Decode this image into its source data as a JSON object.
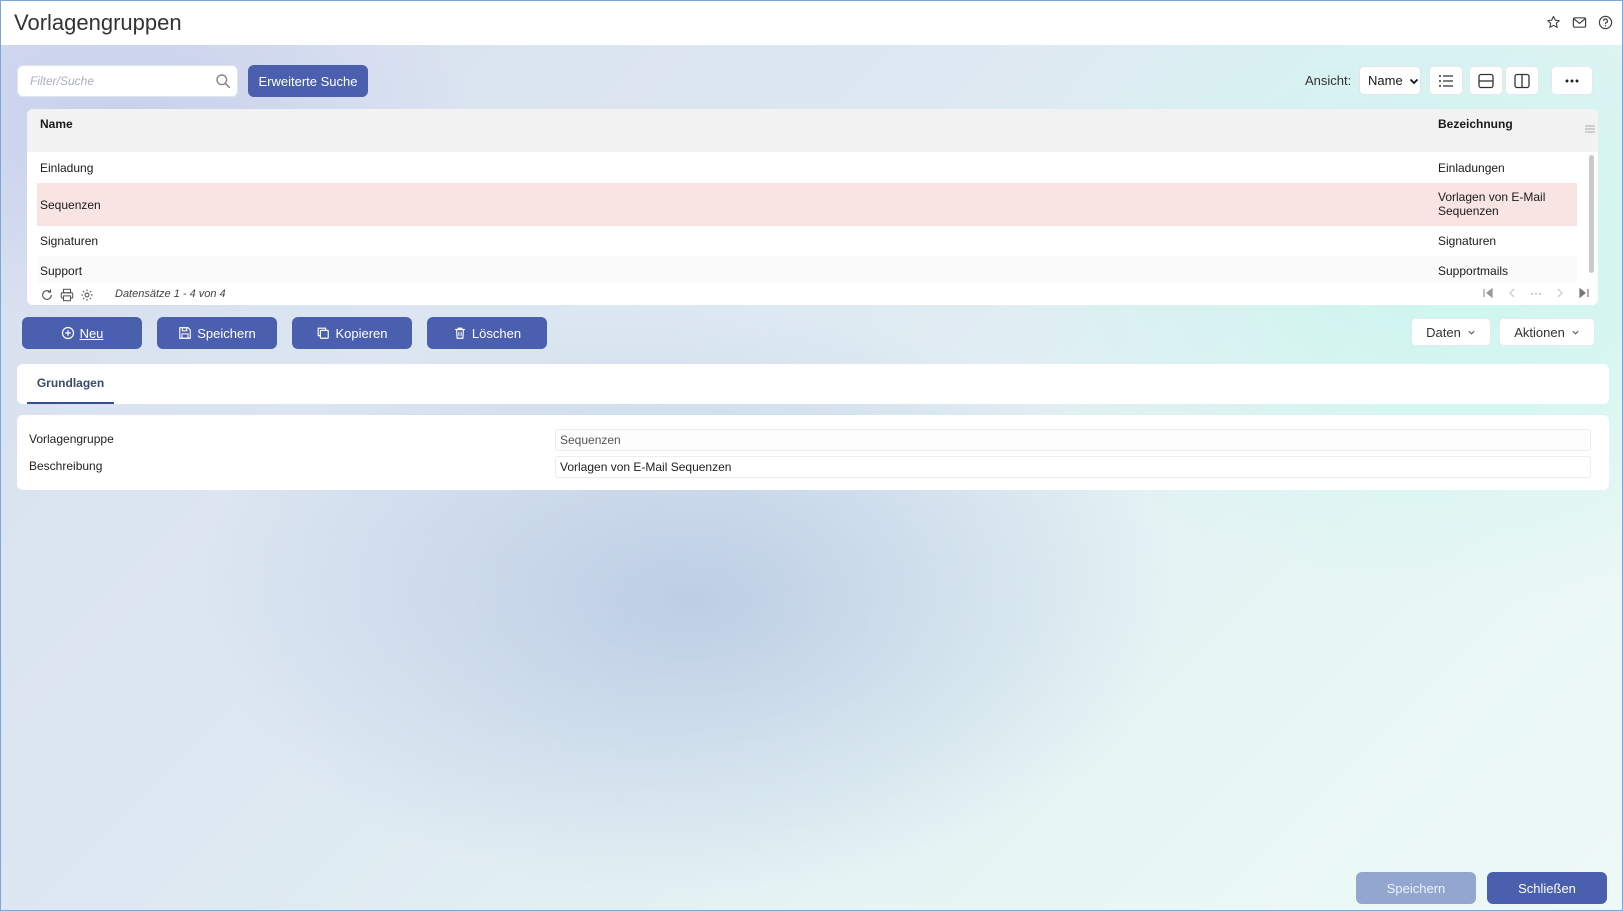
{
  "window": {
    "title": "Vorlagengruppen"
  },
  "search": {
    "placeholder": "Filter/Suche",
    "advanced_label": "Erweiterte Suche"
  },
  "view": {
    "label": "Ansicht:",
    "selected": "Name"
  },
  "grid": {
    "columns": [
      "Name",
      "Bezeichnung"
    ],
    "rows": [
      {
        "name": "Einladung",
        "bezeichnung": "Einladungen"
      },
      {
        "name": "Sequenzen",
        "bezeichnung": "Vorlagen von E-Mail Sequenzen",
        "bezeichnung_line1": "Vorlagen von E-Mail",
        "bezeichnung_line2": "Sequenzen"
      },
      {
        "name": "Signaturen",
        "bezeichnung": "Signaturen"
      },
      {
        "name": "Support",
        "bezeichnung": "Supportmails"
      }
    ],
    "footer": "Datensätze 1 - 4 von 4",
    "pager_more": "···"
  },
  "actions": {
    "new": "Neu",
    "save": "Speichern",
    "copy": "Kopieren",
    "delete": "Löschen",
    "data": "Daten",
    "more_actions": "Aktionen"
  },
  "tabs": [
    {
      "label": "Grundlagen"
    }
  ],
  "form": {
    "group_label": "Vorlagengruppe",
    "group_value": "Sequenzen",
    "desc_label": "Beschreibung",
    "desc_value": "Vorlagen von E-Mail Sequenzen"
  },
  "footer_buttons": {
    "save": "Speichern",
    "close": "Schließen"
  },
  "colors": {
    "primary": "#4a5fae",
    "selected_row": "#f8e5e3",
    "disabled": "#93a6d0"
  }
}
